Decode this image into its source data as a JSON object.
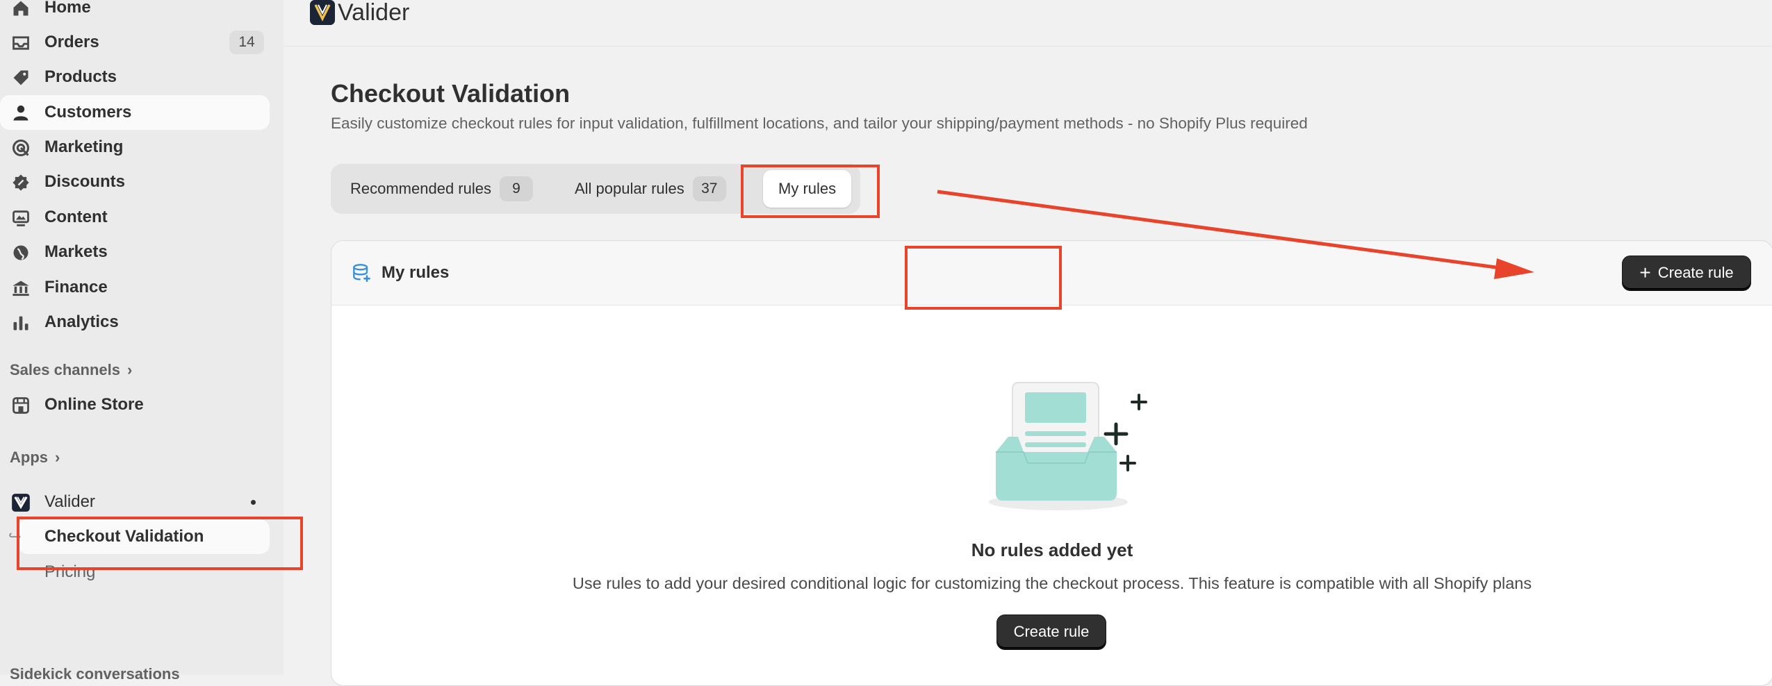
{
  "sidebar": {
    "items": [
      {
        "label": "Home",
        "icon": "home-icon"
      },
      {
        "label": "Orders",
        "icon": "inbox-icon",
        "badge": "14"
      },
      {
        "label": "Products",
        "icon": "tag-icon"
      },
      {
        "label": "Customers",
        "icon": "person-icon"
      },
      {
        "label": "Marketing",
        "icon": "target-icon"
      },
      {
        "label": "Discounts",
        "icon": "discount-icon"
      },
      {
        "label": "Content",
        "icon": "content-icon"
      },
      {
        "label": "Markets",
        "icon": "globe-icon"
      },
      {
        "label": "Finance",
        "icon": "bank-icon"
      },
      {
        "label": "Analytics",
        "icon": "bar-chart-icon"
      }
    ],
    "sales_channels_label": "Sales channels",
    "online_store_label": "Online Store",
    "apps_label": "Apps",
    "app_name": "Valider",
    "app_subitems": [
      "Checkout Validation",
      "Pricing"
    ],
    "bottom_label": "Sidekick conversations"
  },
  "topbar": {
    "app_title": "Valider"
  },
  "page": {
    "title": "Checkout Validation",
    "subtitle": "Easily customize checkout rules for input validation, fulfillment locations, and tailor your shipping/payment methods - no Shopify Plus required"
  },
  "tabs": [
    {
      "label": "Recommended rules",
      "count": "9"
    },
    {
      "label": "All popular rules",
      "count": "37"
    },
    {
      "label": "My rules",
      "count": ""
    }
  ],
  "card": {
    "title": "My rules",
    "create_button": "Create rule",
    "empty_title": "No rules added yet",
    "empty_desc": "Use rules to add your desired conditional logic for customizing the checkout process. This feature is compatible with all Shopify plans",
    "empty_button": "Create rule"
  },
  "colors": {
    "annotation": "#e8432b",
    "accent_teal": "#a3ded5",
    "dark_button": "#303030"
  }
}
